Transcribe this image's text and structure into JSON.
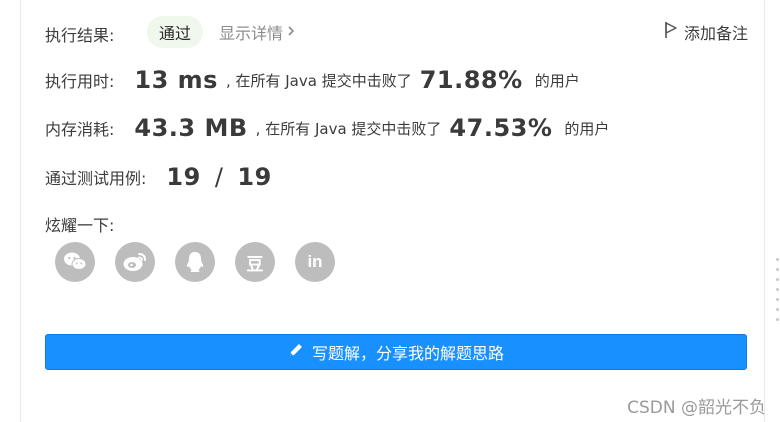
{
  "status": {
    "label": "执行结果:",
    "result_tag": "通过",
    "details_link": "显示详情",
    "add_note": "添加备注"
  },
  "runtime": {
    "label": "执行用时:",
    "value": "13 ms",
    "middle_text": ", 在所有 Java 提交中击败了",
    "percent": "71.88%",
    "suffix": "的用户"
  },
  "memory": {
    "label": "内存消耗:",
    "value": "43.3 MB",
    "middle_text": ", 在所有 Java 提交中击败了",
    "percent": "47.53%",
    "suffix": "的用户"
  },
  "tests": {
    "label": "通过测试用例:",
    "passed": "19",
    "separator": "/",
    "total": "19"
  },
  "share": {
    "label": "炫耀一下:",
    "icons": [
      "wechat-icon",
      "weibo-icon",
      "qq-icon",
      "douban-icon",
      "linkedin-icon"
    ],
    "douban_glyph": "豆",
    "linkedin_glyph": "in"
  },
  "cta": {
    "label": "写题解，分享我的解题思路",
    "icon": "pencil-icon"
  },
  "watermark": "CSDN @韶光不负",
  "colors": {
    "primary": "#1890ff",
    "pass_tag_bg": "#f0f7ec",
    "share_icon_bg": "#bdbdbd"
  }
}
